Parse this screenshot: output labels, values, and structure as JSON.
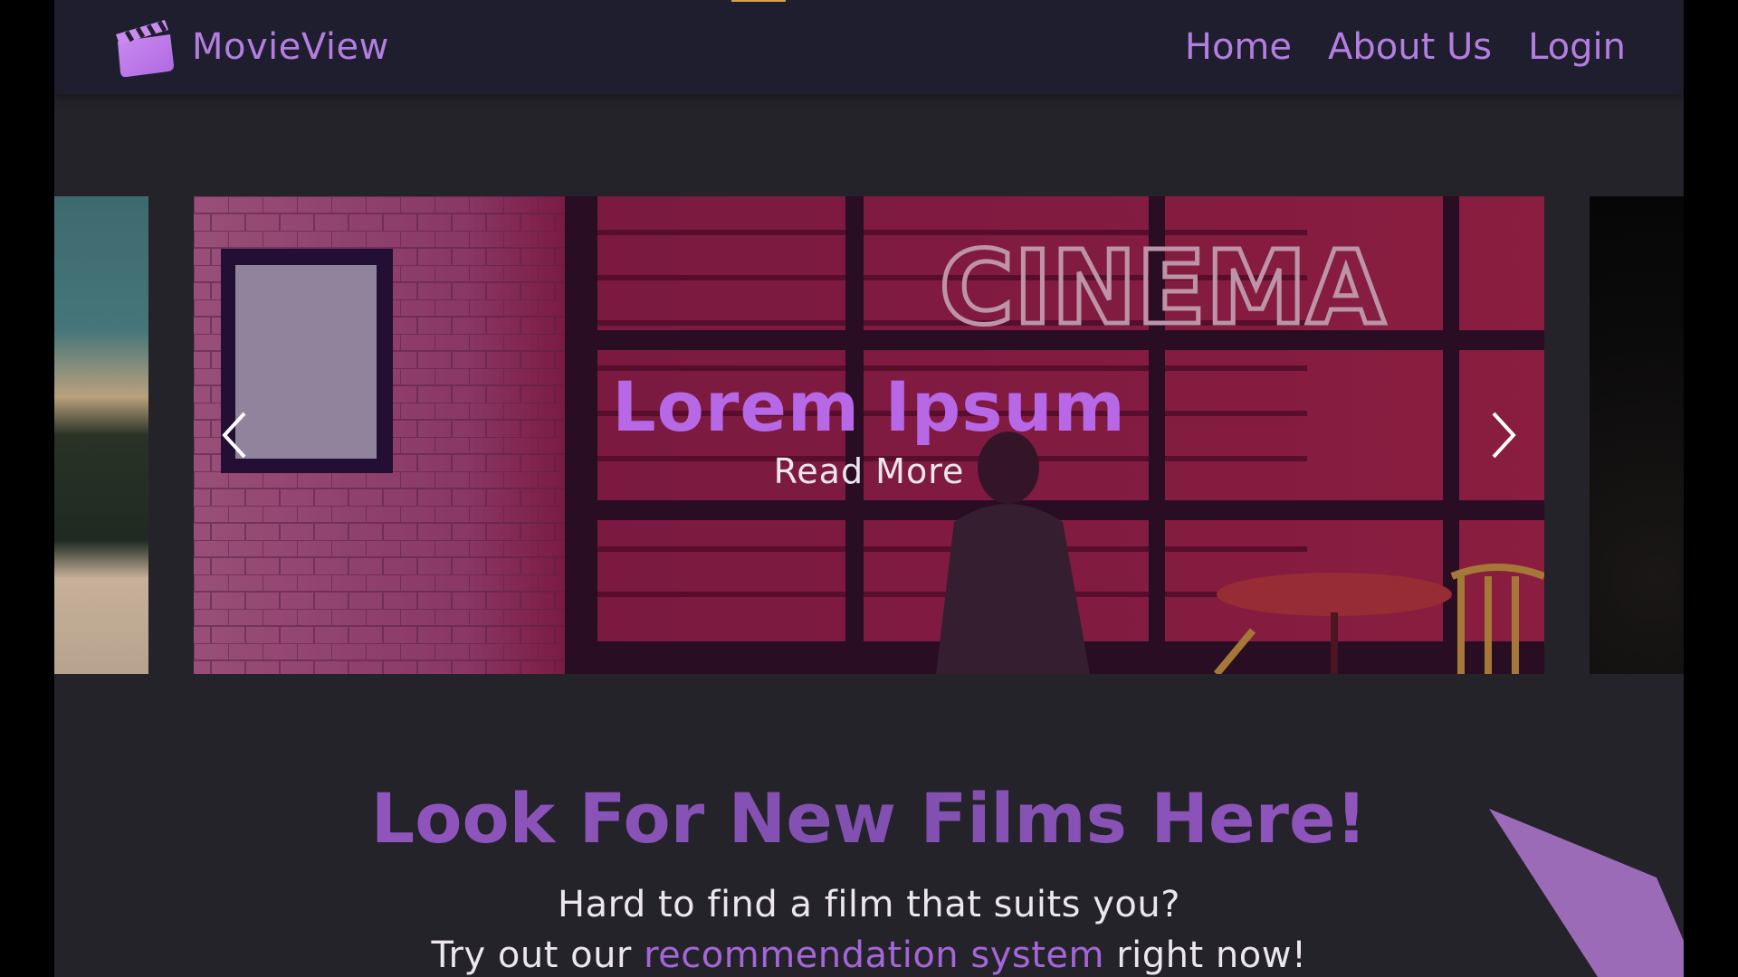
{
  "navbar": {
    "brand": {
      "name": "MovieView",
      "icon": "clapperboard-icon"
    },
    "links": [
      {
        "label": "Home"
      },
      {
        "label": "About Us"
      },
      {
        "label": "Login"
      }
    ]
  },
  "carousel": {
    "slide": {
      "title": "Lorem Ipsum",
      "read_more": "Read More",
      "image_sign": "CINEMA"
    },
    "prev_icon": "chevron-left-icon",
    "next_icon": "chevron-right-icon"
  },
  "intro": {
    "heading": "Look For New Films Here!",
    "line1": "Hard to find a film that suits you?",
    "line2_before": "Try out our ",
    "line2_link": "recommendation system",
    "line2_after": " right now!"
  },
  "colors": {
    "page_bg": "#25232a",
    "navbar_bg": "#1f1e2e",
    "accent": "#b47ee0",
    "heading": "#8b4fb8",
    "text": "#ece6ee"
  }
}
